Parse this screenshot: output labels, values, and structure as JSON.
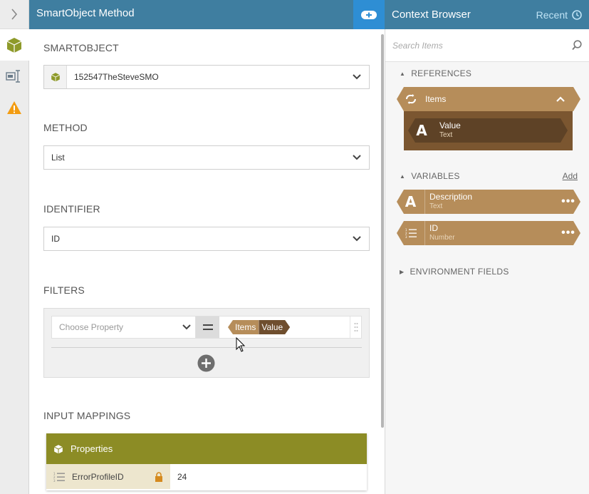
{
  "main_header": {
    "title": "SmartObject Method"
  },
  "smartobject": {
    "label": "SMARTOBJECT",
    "value": "152547TheSteveSMO"
  },
  "method": {
    "label": "METHOD",
    "value": "List"
  },
  "identifier": {
    "label": "IDENTIFIER",
    "value": "ID"
  },
  "filters": {
    "label": "FILTERS",
    "property_placeholder": "Choose Property",
    "value_chip_parent": "Items",
    "value_chip_child": "Value"
  },
  "input_mappings": {
    "label": "INPUT MAPPINGS",
    "header": "Properties",
    "rows": [
      {
        "key": "ErrorProfileID",
        "value": "24"
      }
    ]
  },
  "context_browser": {
    "title": "Context Browser",
    "recent_label": "Recent",
    "search_placeholder": "Search Items",
    "references_label": "REFERENCES",
    "items_label": "Items",
    "value_name": "Value",
    "value_type": "Text",
    "variables_label": "VARIABLES",
    "add_label": "Add",
    "variables": [
      {
        "name": "Description",
        "type": "Text"
      },
      {
        "name": "ID",
        "type": "Number"
      }
    ],
    "environment_label": "ENVIRONMENT FIELDS"
  },
  "colors": {
    "header_blue": "#3f7ea0",
    "accent_blue": "#2e8ed4",
    "reference_tan": "#b68d5a",
    "reference_brown": "#7b5630",
    "mapping_olive": "#8c8c25",
    "warning_orange": "#f39c12",
    "smartobject_green": "#8e9a2a"
  }
}
